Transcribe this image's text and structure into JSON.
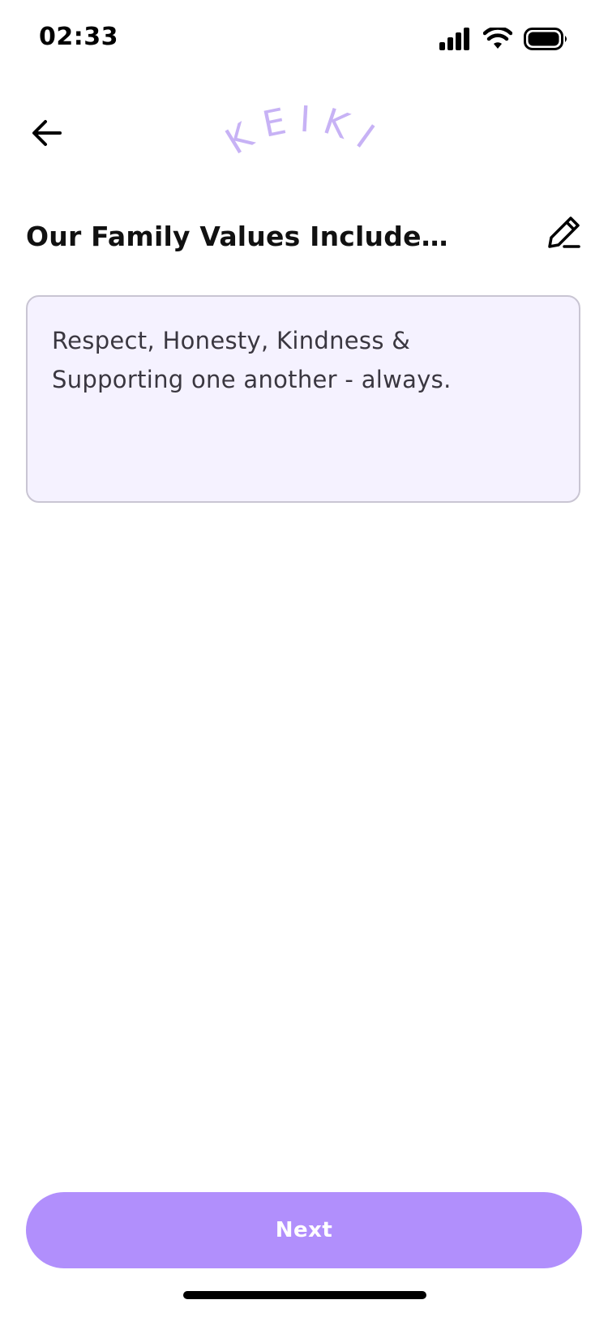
{
  "status_bar": {
    "time": "02:33",
    "icons": [
      "cellular-signal-icon",
      "wifi-icon",
      "battery-icon"
    ]
  },
  "header": {
    "back_icon": "arrow-left-icon",
    "logo_text": "KEIKI",
    "logo_color": "#c7b2f5"
  },
  "section": {
    "title": "Our Family Values Include…",
    "edit_icon": "pencil-icon"
  },
  "values_field": {
    "value": "Respect, Honesty, Kindness & Supporting one another - always."
  },
  "footer": {
    "next_label": "Next",
    "button_color": "#b18ffc"
  }
}
